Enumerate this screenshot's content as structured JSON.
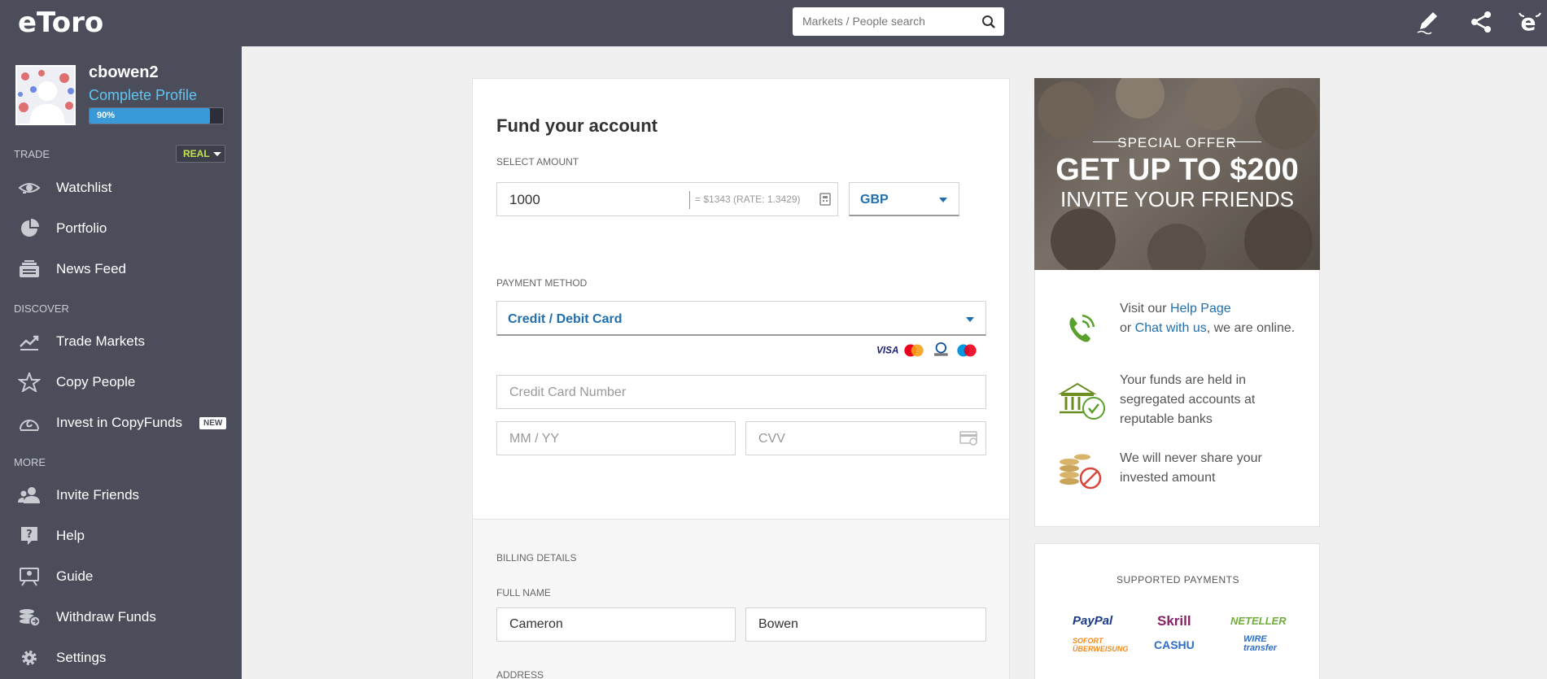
{
  "brand": {
    "logo_text": "eToro"
  },
  "profile": {
    "username": "cbowen2",
    "complete_profile_link": "Complete Profile",
    "progress_label": "90%",
    "progress_fraction": 0.9
  },
  "sidebar": {
    "trade_label": "TRADE",
    "account_mode": "REAL",
    "discover_label": "DISCOVER",
    "more_label": "MORE",
    "new_badge": "NEW",
    "items": [
      {
        "label": "Watchlist",
        "icon": "eye-icon"
      },
      {
        "label": "Portfolio",
        "icon": "pie-chart-icon"
      },
      {
        "label": "News Feed",
        "icon": "news-feed-icon"
      },
      {
        "label": "Trade Markets",
        "icon": "trend-chart-icon"
      },
      {
        "label": "Copy People",
        "icon": "star-icon"
      },
      {
        "label": "Invest in CopyFunds",
        "icon": "copyfunds-icon"
      },
      {
        "label": "Invite Friends",
        "icon": "people-icon"
      },
      {
        "label": "Help",
        "icon": "help-icon"
      },
      {
        "label": "Guide",
        "icon": "guide-icon"
      },
      {
        "label": "Withdraw Funds",
        "icon": "withdraw-icon"
      },
      {
        "label": "Settings",
        "icon": "gear-icon"
      }
    ]
  },
  "topbar": {
    "search_placeholder": "Markets / People search",
    "icons": [
      "pencil-icon",
      "share-icon",
      "etoro-e-icon"
    ]
  },
  "fund": {
    "title": "Fund your account",
    "select_amount_label": "SELECT AMOUNT",
    "amount_value": "1000",
    "conversion_text": "= $1343   (RATE: 1.3429)",
    "currency": "GBP",
    "payment_method_label": "PAYMENT METHOD",
    "payment_method": "Credit / Debit Card",
    "card_logos": [
      "VISA",
      "MasterCard",
      "Diners Club",
      "Maestro"
    ],
    "card_number_placeholder": "Credit Card Number",
    "expiry_placeholder": "MM / YY",
    "cvv_placeholder": "CVV",
    "billing_label": "BILLING DETAILS",
    "full_name_label": "FULL NAME",
    "first_name": "Cameron",
    "last_name": "Bowen",
    "address_label": "ADDRESS"
  },
  "promo": {
    "special_offer": "SPECIAL OFFER",
    "headline": "GET UP TO $200",
    "subline": "INVITE YOUR FRIENDS"
  },
  "info": {
    "help_prefix": "Visit our ",
    "help_link": "Help Page",
    "chat_prefix": "or ",
    "chat_link": "Chat with us",
    "chat_suffix": ", we are online.",
    "funds_text": "Your funds are held in segregated accounts at reputable banks",
    "share_text": "We will never share your invested amount"
  },
  "payments": {
    "title": "SUPPORTED PAYMENTS",
    "logos": [
      "PayPal",
      "Skrill",
      "NETELLER",
      "SOFORT ÜBERWEISUNG",
      "CASHU",
      "WIRE transfer"
    ]
  }
}
